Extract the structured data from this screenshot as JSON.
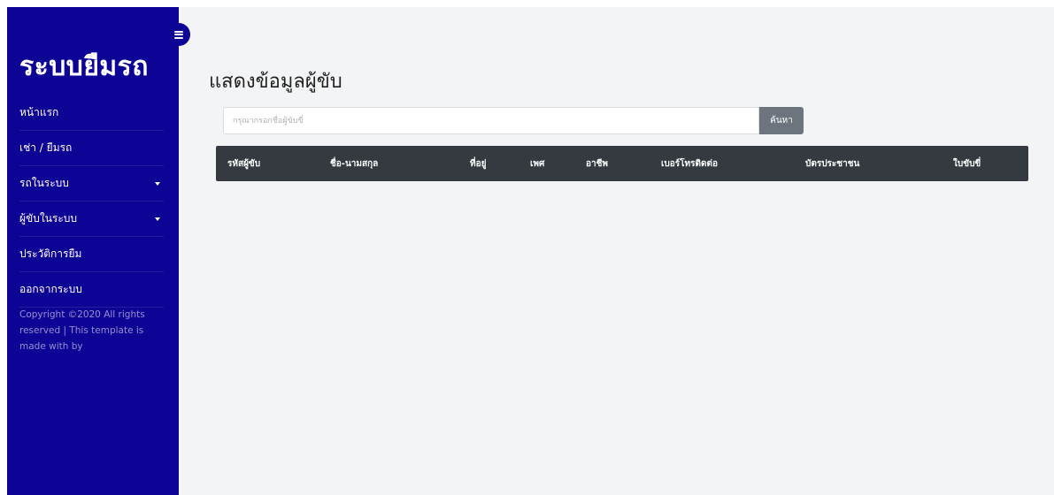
{
  "app": {
    "brand_title": "ระบบยืมรถ"
  },
  "sidebar": {
    "items": [
      {
        "label": "หน้าแรก",
        "has_dropdown": false
      },
      {
        "label": "เช่า / ยืมรถ",
        "has_dropdown": false
      },
      {
        "label": "รถในระบบ",
        "has_dropdown": true
      },
      {
        "label": "ผู้ขับในระบบ",
        "has_dropdown": true
      },
      {
        "label": "ประวัติการยืม",
        "has_dropdown": false
      },
      {
        "label": "ออกจากระบบ",
        "has_dropdown": false
      }
    ],
    "copyright": "Copyright ©2020 All rights reserved | This template is made with by",
    "toggle_icon": "hamburger-icon"
  },
  "main": {
    "page_title": "แสดงข้อมูลผู้ขับ",
    "search": {
      "placeholder": "กรุณากรอกชื่อผู้ขับขี่",
      "value": "",
      "button_label": "ค้นหา"
    },
    "table": {
      "columns": [
        "รหัสผู้ขับ",
        "ชื่อ-นามสกุล",
        "ที่อยู่",
        "เพศ",
        "อาชีพ",
        "เบอร์โทรติดต่อ",
        "บัตรประชาชน",
        "ใบขับขี่"
      ],
      "rows": []
    }
  },
  "colors": {
    "sidebar_bg": "#0d0394",
    "content_bg": "#f2f4f5",
    "table_header_bg": "#343a40",
    "search_button_bg": "#6c757d"
  }
}
